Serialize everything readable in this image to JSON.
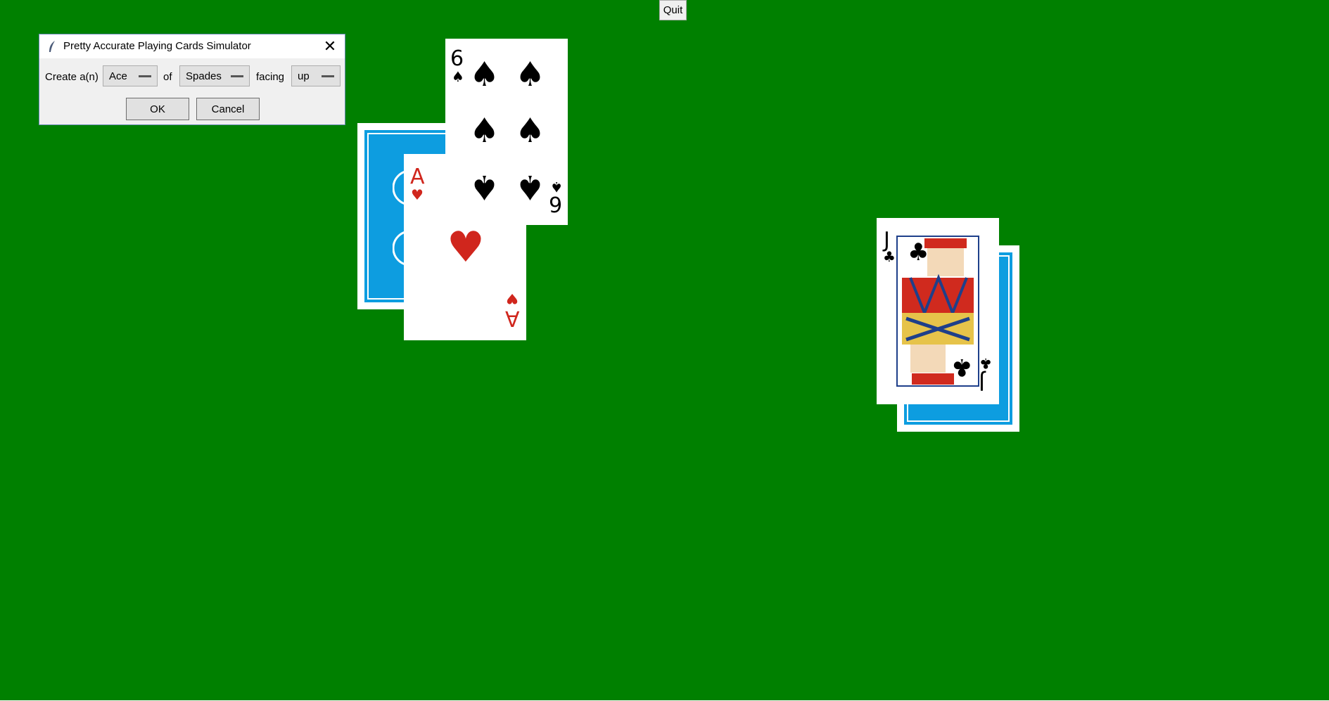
{
  "toolbar": {
    "quit_label": "Quit"
  },
  "dialog": {
    "title": "Pretty Accurate Playing Cards Simulator",
    "create_label": "Create a(n)",
    "rank_value": "Ace",
    "of_label": "of",
    "suit_value": "Spades",
    "facing_label": "facing",
    "facing_value": "up",
    "ok_label": "OK",
    "cancel_label": "Cancel",
    "close_glyph": "✕"
  },
  "cards": {
    "ace_hearts": {
      "rank": "A",
      "suit": "♥",
      "color": "#d0261d"
    },
    "six_spades": {
      "rank": "6",
      "suit": "♠",
      "color": "#000000"
    },
    "jack_clubs": {
      "rank": "J",
      "suit": "♣",
      "color": "#000000"
    }
  },
  "colors": {
    "felt": "#008000",
    "card_back": "#0d9de0"
  }
}
